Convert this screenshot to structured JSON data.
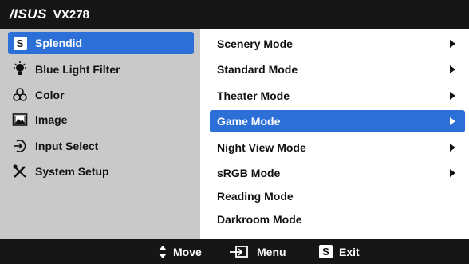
{
  "header": {
    "brand": "/ISUS",
    "model": "VX278"
  },
  "left_menu": [
    {
      "label": "Splendid",
      "icon": "splendid-s-icon",
      "selected": true
    },
    {
      "label": "Blue Light Filter",
      "icon": "lightbulb-icon",
      "selected": false
    },
    {
      "label": "Color",
      "icon": "color-circles-icon",
      "selected": false
    },
    {
      "label": "Image",
      "icon": "image-icon",
      "selected": false
    },
    {
      "label": "Input Select",
      "icon": "input-arrow-icon",
      "selected": false
    },
    {
      "label": "System Setup",
      "icon": "tools-icon",
      "selected": false
    }
  ],
  "right_menu": [
    {
      "label": "Scenery Mode",
      "has_arrow": true,
      "selected": false
    },
    {
      "label": "Standard Mode",
      "has_arrow": true,
      "selected": false
    },
    {
      "label": "Theater Mode",
      "has_arrow": true,
      "selected": false
    },
    {
      "label": "Game Mode",
      "has_arrow": true,
      "selected": true
    },
    {
      "label": "Night View Mode",
      "has_arrow": true,
      "selected": false
    },
    {
      "label": "sRGB Mode",
      "has_arrow": true,
      "selected": false
    },
    {
      "label": "Reading Mode",
      "has_arrow": false,
      "selected": false
    },
    {
      "label": "Darkroom Mode",
      "has_arrow": false,
      "selected": false
    }
  ],
  "footer": {
    "move_label": "Move",
    "menu_label": "Menu",
    "exit_label": "Exit",
    "exit_badge": "S"
  },
  "left_badge": "S",
  "colors": {
    "accent": "#2c6fd6",
    "left_bg": "#c9c9c9",
    "bar_bg": "#161616"
  }
}
